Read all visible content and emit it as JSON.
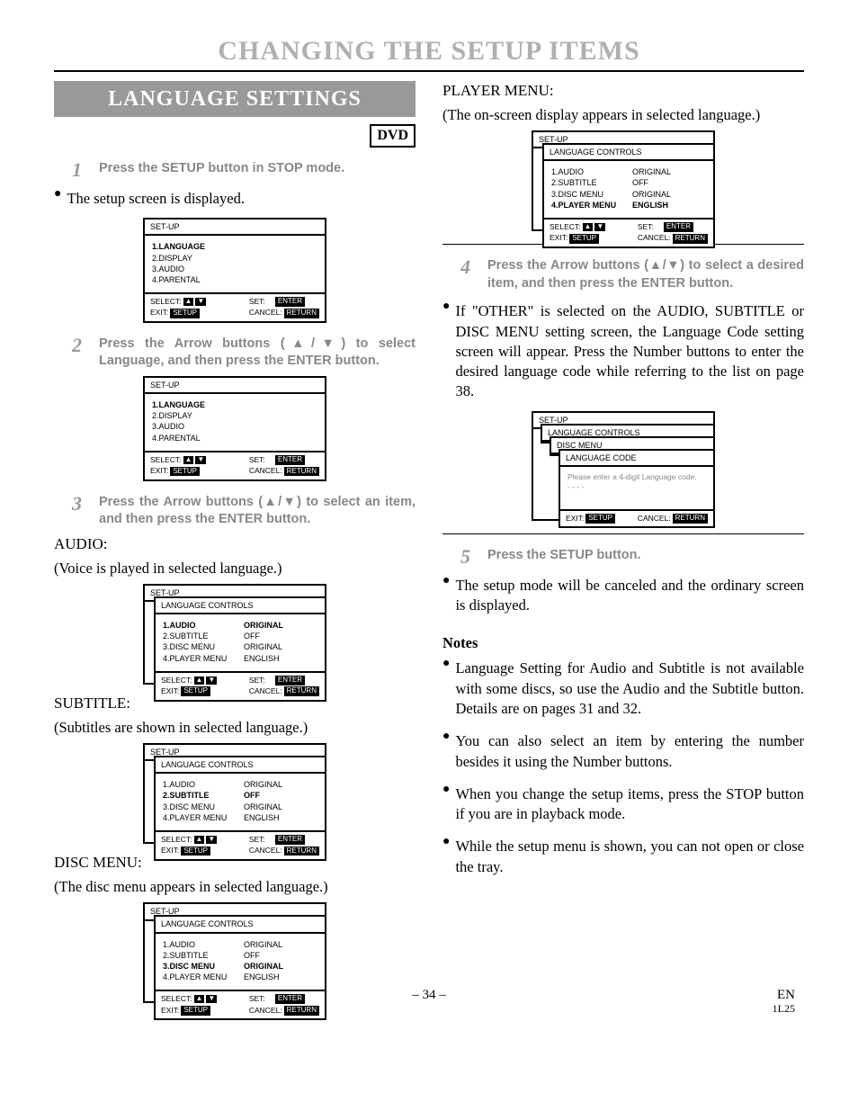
{
  "mainTitle": "CHANGING THE SETUP ITEMS",
  "sectionBanner": "LANGUAGE SETTINGS",
  "dvdBadge": "DVD",
  "steps": {
    "s1": {
      "num": "1",
      "txt": "Press the SETUP button in STOP mode."
    },
    "s2": {
      "num": "2",
      "txt": "Press the Arrow buttons (▲/▼) to select Language, and then press the ENTER button."
    },
    "s3": {
      "num": "3",
      "txt": "Press the Arrow buttons (▲/▼) to select an item, and then press the ENTER button."
    },
    "s4": {
      "num": "4",
      "txt": "Press the Arrow buttons (▲/▼) to select a desired item, and then press the ENTER button."
    },
    "s5": {
      "num": "5",
      "txt": "Press the SETUP button."
    }
  },
  "bullets": {
    "b1": "The setup screen is displayed.",
    "bOther": "If \"OTHER\" is selected on the AUDIO, SUBTITLE or DISC MENU setting screen, the Language Code setting screen will appear. Press the Number buttons to enter the desired language code while referring to the list on page 38.",
    "b5": "The setup mode will be canceled and the ordinary screen is displayed.",
    "n1": "Language Setting for Audio and Subtitle is not available with some discs, so use the Audio and the Subtitle button. Details are on pages 31 and 32.",
    "n2": "You can also select an item by entering the number besides it using the Number buttons.",
    "n3": "When you change the setup items, press the STOP button if you are in playback mode.",
    "n4": "While the setup menu is shown, you can not open or close the tray."
  },
  "labels": {
    "audioHead": "AUDIO:",
    "audioSub": "(Voice is played in selected language.)",
    "subtitleHead": "SUBTITLE:",
    "subtitleSub": "(Subtitles are shown in selected language.)",
    "discHead": "DISC MENU:",
    "discSub": "(The disc menu appears in selected language.)",
    "playerHead": "PLAYER MENU:",
    "playerSub": "(The on-screen display appears in selected language.)",
    "notes": "Notes"
  },
  "osd": {
    "setup": "SET-UP",
    "langControls": "LANGUAGE CONTROLS",
    "discMenu": "DISC MENU",
    "langCode": "LANGUAGE CODE",
    "codePrompt": "Please enter a 4-digit Language code.",
    "dashes": "- - - -",
    "menu": {
      "l1": "1.LANGUAGE",
      "l2": "2.DISPLAY",
      "l3": "3.AUDIO",
      "l4": "4.PARENTAL"
    },
    "lang": {
      "r1": {
        "k": "1.AUDIO",
        "v": "ORIGINAL"
      },
      "r2": {
        "k": "2.SUBTITLE",
        "v": "OFF"
      },
      "r3": {
        "k": "3.DISC MENU",
        "v": "ORIGINAL"
      },
      "r4": {
        "k": "4.PLAYER MENU",
        "v": "ENGLISH"
      }
    },
    "ftr": {
      "select": "SELECT:",
      "exit": "EXIT:",
      "set": "SET:",
      "cancel": "CANCEL:",
      "setup": "SETUP",
      "enter": "ENTER",
      "return": "RETURN"
    }
  },
  "footer": {
    "page": "– 34 –",
    "lang": "EN",
    "code": "1L25"
  }
}
